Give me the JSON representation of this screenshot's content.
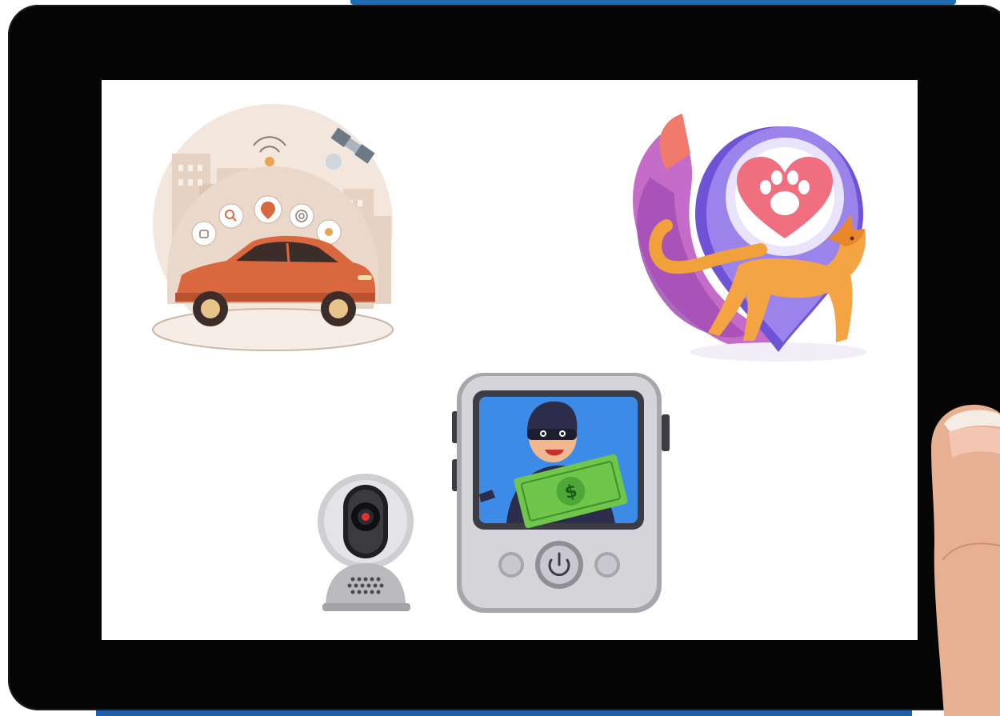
{
  "scene": {
    "colors": {
      "tablet_frame": "#050505",
      "screen": "#ffffff",
      "top_accent": "#1f6cb4",
      "bottom_accent": "#1f5fa8",
      "skin": "#eab49a"
    },
    "illustrations": [
      {
        "name": "connected-car",
        "icon": "car-gps-icon",
        "accent": "#d9683e"
      },
      {
        "name": "pet-location-pin",
        "icon": "paw-heart-pin-icon",
        "accent": "#8a6be0"
      },
      {
        "name": "security-camera",
        "icon": "security-camera-icon",
        "accent": "#c9c9cd"
      },
      {
        "name": "video-doorbell-viewer",
        "icon": "burglar-alert-icon",
        "accent": "#3c8be6"
      }
    ]
  }
}
